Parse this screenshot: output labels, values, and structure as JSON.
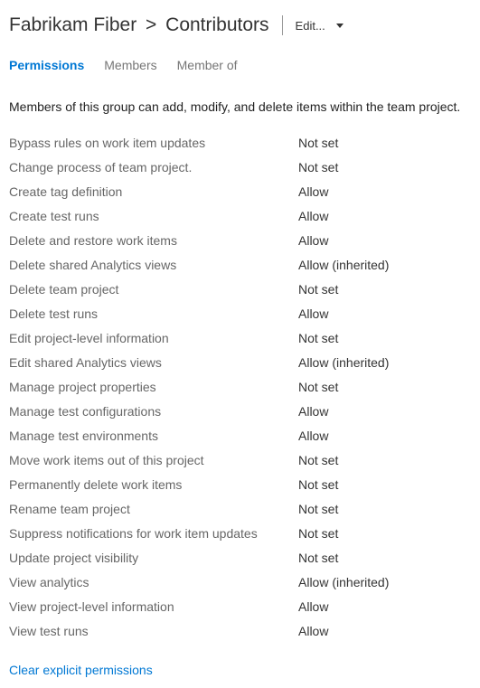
{
  "header": {
    "breadcrumb_project": "Fabrikam Fiber",
    "breadcrumb_sep": ">",
    "breadcrumb_group": "Contributors",
    "edit_label": "Edit..."
  },
  "tabs": {
    "permissions": "Permissions",
    "members": "Members",
    "member_of": "Member of"
  },
  "description": "Members of this group can add, modify, and delete items within the team project.",
  "permissions": [
    {
      "name": "Bypass rules on work item updates",
      "value": "Not set"
    },
    {
      "name": "Change process of team project.",
      "value": "Not set"
    },
    {
      "name": "Create tag definition",
      "value": "Allow"
    },
    {
      "name": "Create test runs",
      "value": "Allow"
    },
    {
      "name": "Delete and restore work items",
      "value": "Allow"
    },
    {
      "name": "Delete shared Analytics views",
      "value": "Allow (inherited)"
    },
    {
      "name": "Delete team project",
      "value": "Not set"
    },
    {
      "name": "Delete test runs",
      "value": "Allow"
    },
    {
      "name": "Edit project-level information",
      "value": "Not set"
    },
    {
      "name": "Edit shared Analytics views",
      "value": "Allow (inherited)"
    },
    {
      "name": "Manage project properties",
      "value": "Not set"
    },
    {
      "name": "Manage test configurations",
      "value": "Allow"
    },
    {
      "name": "Manage test environments",
      "value": "Allow"
    },
    {
      "name": "Move work items out of this project",
      "value": "Not set"
    },
    {
      "name": "Permanently delete work items",
      "value": "Not set"
    },
    {
      "name": "Rename team project",
      "value": "Not set"
    },
    {
      "name": "Suppress notifications for work item updates",
      "value": "Not set"
    },
    {
      "name": "Update project visibility",
      "value": "Not set"
    },
    {
      "name": "View analytics",
      "value": "Allow (inherited)"
    },
    {
      "name": "View project-level information",
      "value": "Allow"
    },
    {
      "name": "View test runs",
      "value": "Allow"
    }
  ],
  "actions": {
    "clear": "Clear explicit permissions"
  }
}
